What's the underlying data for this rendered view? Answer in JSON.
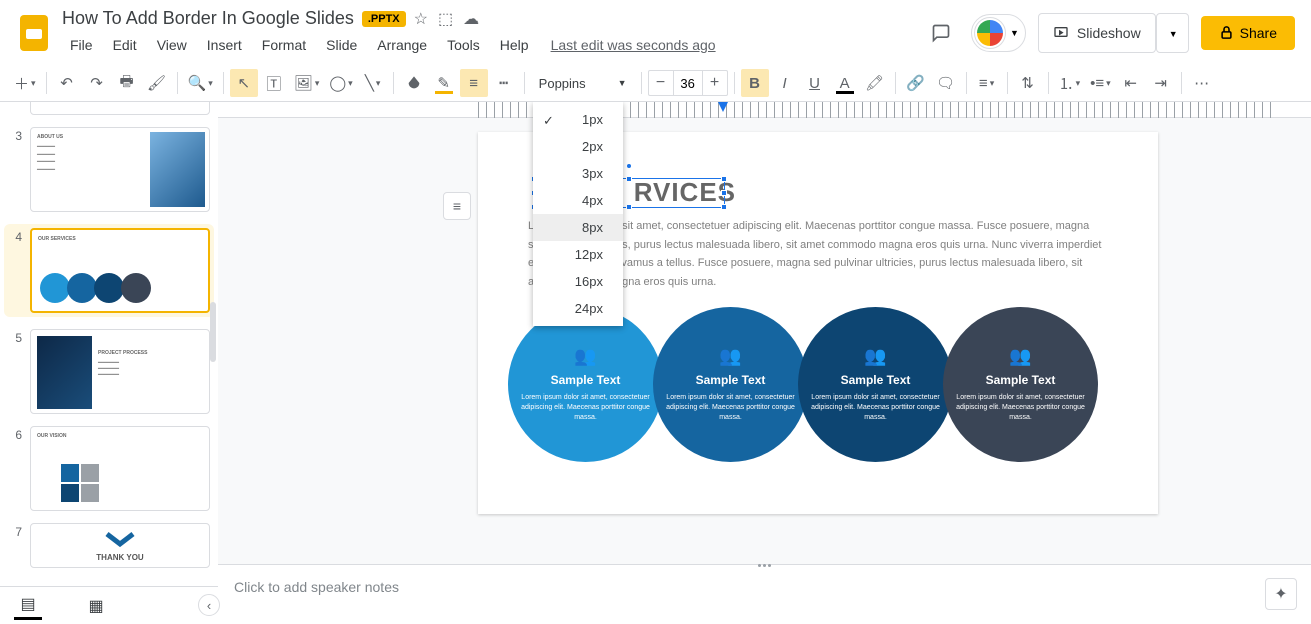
{
  "header": {
    "doc_title": "How To Add Border In Google Slides",
    "badge": ".PPTX",
    "last_edit": "Last edit was seconds ago",
    "slideshow_label": "Slideshow",
    "share_label": "Share"
  },
  "menu": {
    "file": "File",
    "edit": "Edit",
    "view": "View",
    "insert": "Insert",
    "format": "Format",
    "slide": "Slide",
    "arrange": "Arrange",
    "tools": "Tools",
    "help": "Help"
  },
  "toolbar": {
    "font_name": "Poppins",
    "font_size": "36"
  },
  "border_weight_menu": {
    "options": [
      "1px",
      "2px",
      "3px",
      "4px",
      "8px",
      "12px",
      "16px",
      "24px"
    ],
    "selected": "1px",
    "highlighted": "8px"
  },
  "thumbnails": [
    {
      "num": "3",
      "title": "ABOUT US"
    },
    {
      "num": "4",
      "title": "OUR SERVICES",
      "selected": true
    },
    {
      "num": "5",
      "title": "PROJECT PROCESS"
    },
    {
      "num": "6",
      "title": "OUR VISION"
    },
    {
      "num": "7",
      "title": "THANK YOU"
    }
  ],
  "slide": {
    "title_visible": "RVICES",
    "body": "Lorem ipsum dolor sit amet, consectetuer adipiscing elit. Maecenas porttitor congue massa. Fusce posuere, magna sed pulvinar ultricies, purus lectus malesuada libero, sit amet commodo magna eros quis urna. Nunc viverra imperdiet enim. Fusce est. Vivamus a tellus. Fusce posuere, magna sed pulvinar ultricies, purus lectus malesuada libero, sit amet commodo magna eros quis urna.",
    "circles": [
      {
        "title": "Sample Text",
        "text": "Lorem ipsum dolor sit amet, consectetuer adipiscing elit. Maecenas porttitor congue massa."
      },
      {
        "title": "Sample Text",
        "text": "Lorem ipsum dolor sit amet, consectetuer adipiscing elit. Maecenas porttitor congue massa."
      },
      {
        "title": "Sample Text",
        "text": "Lorem ipsum dolor sit amet, consectetuer adipiscing elit. Maecenas porttitor congue massa."
      },
      {
        "title": "Sample Text",
        "text": "Lorem ipsum dolor sit amet, consectetuer adipiscing elit. Maecenas porttitor congue massa."
      }
    ]
  },
  "notes": {
    "placeholder": "Click to add speaker notes"
  }
}
